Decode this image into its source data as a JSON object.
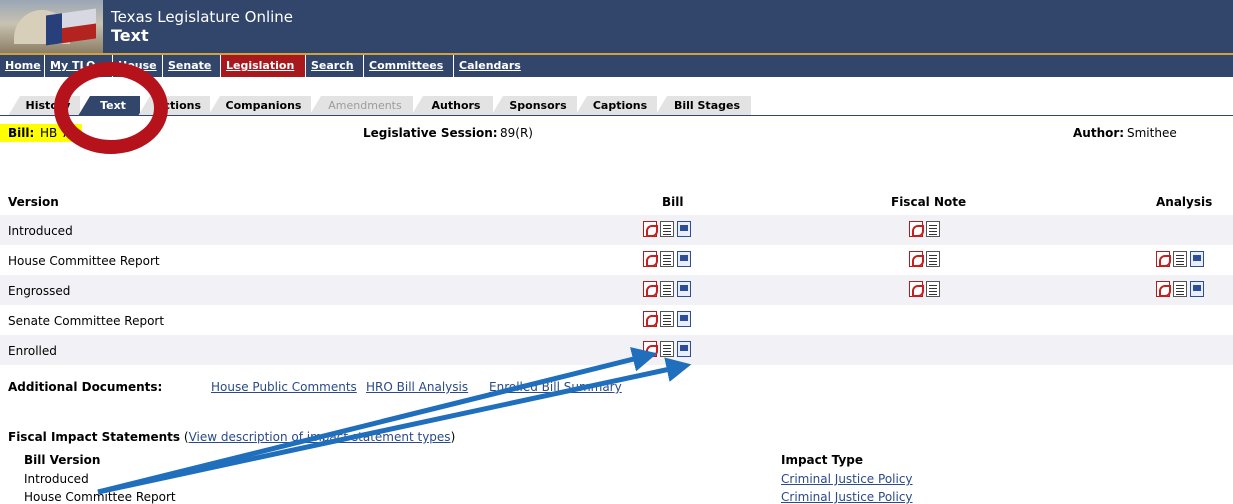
{
  "header": {
    "site_name": "Texas Legislature Online",
    "page_name": "Text"
  },
  "nav": [
    "Home",
    "My TLO",
    "House",
    "Senate",
    "Legislation",
    "Search",
    "Committees",
    "Calendars"
  ],
  "tabs": [
    "History",
    "Text",
    "Actions",
    "Companions",
    "Amendments",
    "Authors",
    "Sponsors",
    "Captions",
    "Bill Stages"
  ],
  "bill_info": {
    "bill_label": "Bill:",
    "bill_value": "HB 7",
    "session_label": "Legislative Session:",
    "session_value": "89(R)",
    "author_label": "Author:",
    "author_value": "Smithee"
  },
  "table": {
    "headers": [
      "Version",
      "Bill",
      "Fiscal Note",
      "Analysis"
    ],
    "rows": [
      "Introduced",
      "House Committee Report",
      "Engrossed",
      "Senate Committee Report",
      "Enrolled"
    ]
  },
  "additional": {
    "label": "Additional Documents:",
    "links": [
      "House Public Comments",
      "HRO Bill Analysis",
      "Enrolled Bill Summary"
    ]
  },
  "fiscal_impact": {
    "title": "Fiscal Impact Statements",
    "paren_open": "(",
    "link": "View description of impact statement types",
    "paren_close": ")",
    "col_version": "Bill Version",
    "col_type": "Impact Type",
    "rows": [
      {
        "version": "Introduced",
        "type": "Criminal Justice Policy"
      },
      {
        "version": "House Committee Report",
        "type": "Criminal Justice Policy"
      }
    ]
  },
  "icons": {
    "pdf": "pdf-file-icon",
    "text": "text-file-icon",
    "word": "word-file-icon"
  },
  "colors": {
    "nav_bg": "#32466b",
    "active_nav": "#a8191e",
    "highlight": "#ffff00",
    "annotation_red": "#b5121b",
    "annotation_blue": "#1f6fbd"
  }
}
